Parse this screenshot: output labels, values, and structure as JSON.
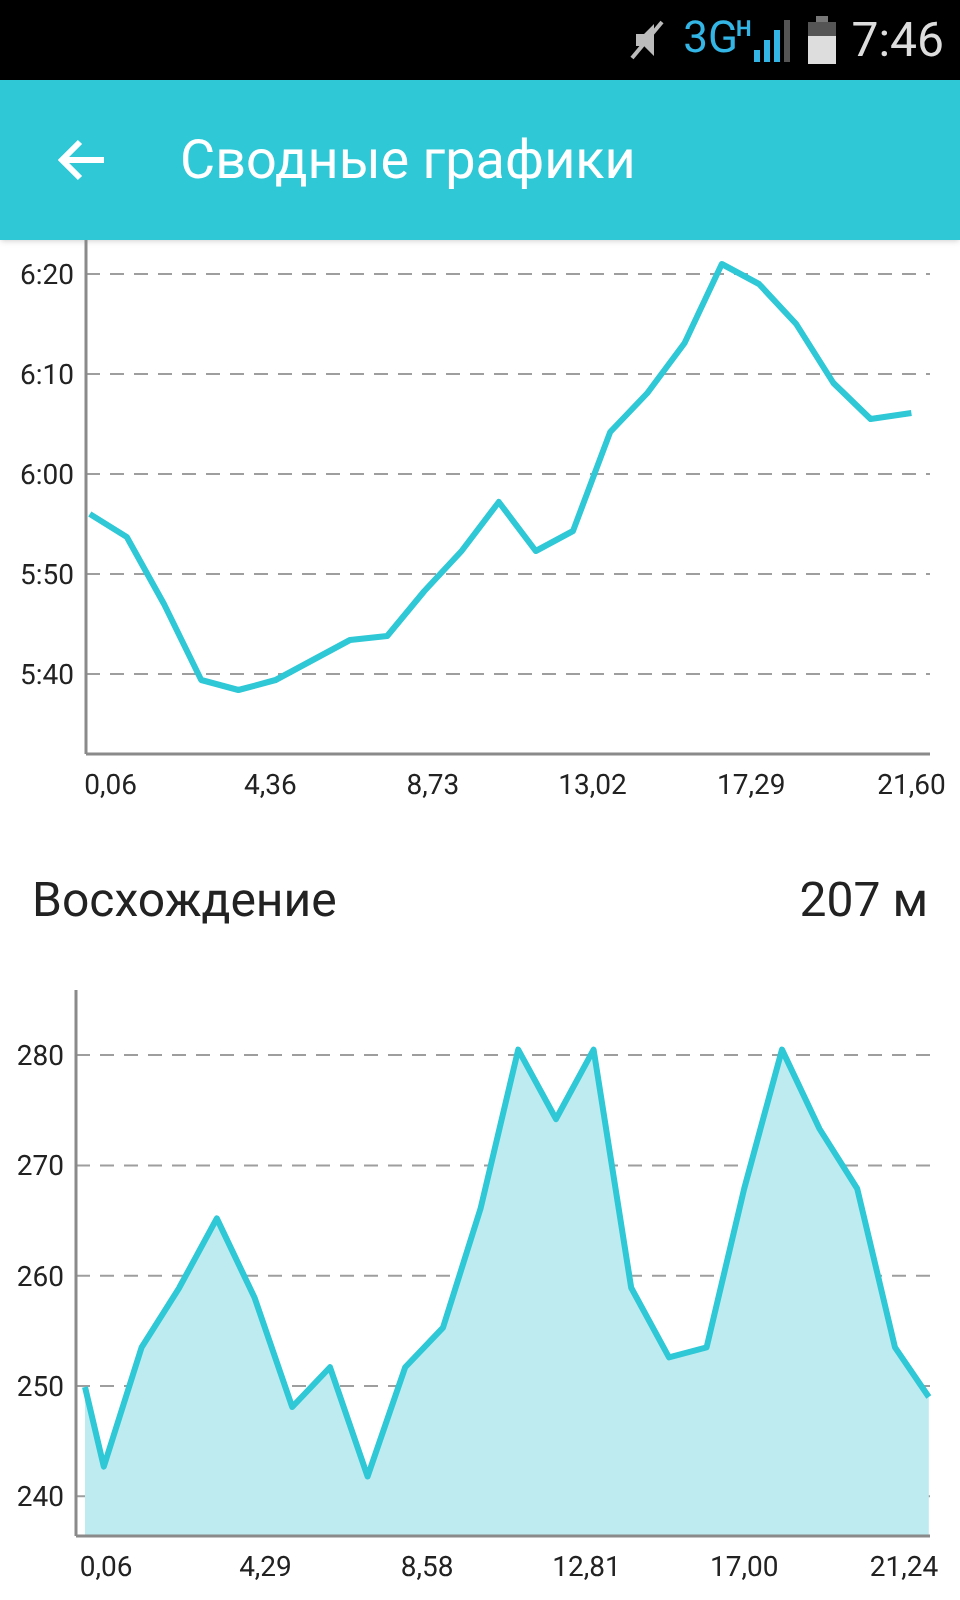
{
  "status_bar": {
    "network": "3G",
    "network_sub": "H",
    "time": "7:46"
  },
  "app_bar": {
    "title": "Сводные графики"
  },
  "pace_chart": {
    "chart_data": {
      "type": "line",
      "xlim": [
        -0.6,
        22.1
      ],
      "ylim": [
        332,
        383.4
      ],
      "x": [
        -0.5,
        0.5,
        1.5,
        2.5,
        3.5,
        4.5,
        5.5,
        6.5,
        7.5,
        8.5,
        9.5,
        10.5,
        11.5,
        12.5,
        13.5,
        14.5,
        15.5,
        16.5,
        17.5,
        18.5,
        19.5,
        20.5,
        21.6
      ],
      "grid": true,
      "series": [
        {
          "color": "#2ec8d6",
          "values": [
            356,
            353.7,
            347,
            339.4,
            338.4,
            339.4,
            341.4,
            343.4,
            343.8,
            348.3,
            352.3,
            357.2,
            352.3,
            354.3,
            364.2,
            368.1,
            373.1,
            381,
            379,
            375,
            369.1,
            365.5,
            366.1
          ]
        }
      ],
      "xticks": [
        {
          "value": 0.06,
          "label": "0,06"
        },
        {
          "value": 4.36,
          "label": "4,36"
        },
        {
          "value": 8.73,
          "label": "8,73"
        },
        {
          "value": 13.02,
          "label": "13,02"
        },
        {
          "value": 17.29,
          "label": "17,29"
        },
        {
          "value": 21.6,
          "label": "21,60"
        }
      ],
      "yticks": [
        {
          "value": 340,
          "label": "5:40"
        },
        {
          "value": 350,
          "label": "5:50"
        },
        {
          "value": 360,
          "label": "6:00"
        },
        {
          "value": 370,
          "label": "6:10"
        },
        {
          "value": 380,
          "label": "6:20"
        }
      ]
    }
  },
  "ascent": {
    "label": "Восхождение",
    "value": "207 м"
  },
  "elevation_chart": {
    "chart_data": {
      "type": "area",
      "xlim": [
        -0.74,
        21.93
      ],
      "ylim": [
        236.4,
        285.9
      ],
      "x": [
        -0.5,
        0,
        1,
        2,
        3,
        4,
        5,
        6,
        7,
        8,
        9,
        10,
        11,
        12,
        13,
        14,
        15,
        16,
        17,
        18,
        19,
        20,
        21,
        21.9
      ],
      "grid": true,
      "series": [
        {
          "color": "#2ec8d6",
          "values": [
            249.9,
            242.7,
            253.5,
            258.9,
            265.2,
            258,
            248.1,
            251.7,
            241.8,
            251.7,
            255.3,
            266.1,
            280.5,
            274.2,
            280.5,
            258.9,
            252.6,
            253.5,
            267.9,
            280.5,
            273.3,
            267.9,
            253.5,
            249
          ]
        }
      ],
      "xticks": [
        {
          "value": 0.06,
          "label": "0,06"
        },
        {
          "value": 4.29,
          "label": "4,29"
        },
        {
          "value": 8.58,
          "label": "8,58"
        },
        {
          "value": 12.81,
          "label": "12,81"
        },
        {
          "value": 17.0,
          "label": "17,00"
        },
        {
          "value": 21.24,
          "label": "21,24"
        }
      ],
      "yticks": [
        240,
        250,
        260,
        270,
        280
      ]
    }
  }
}
